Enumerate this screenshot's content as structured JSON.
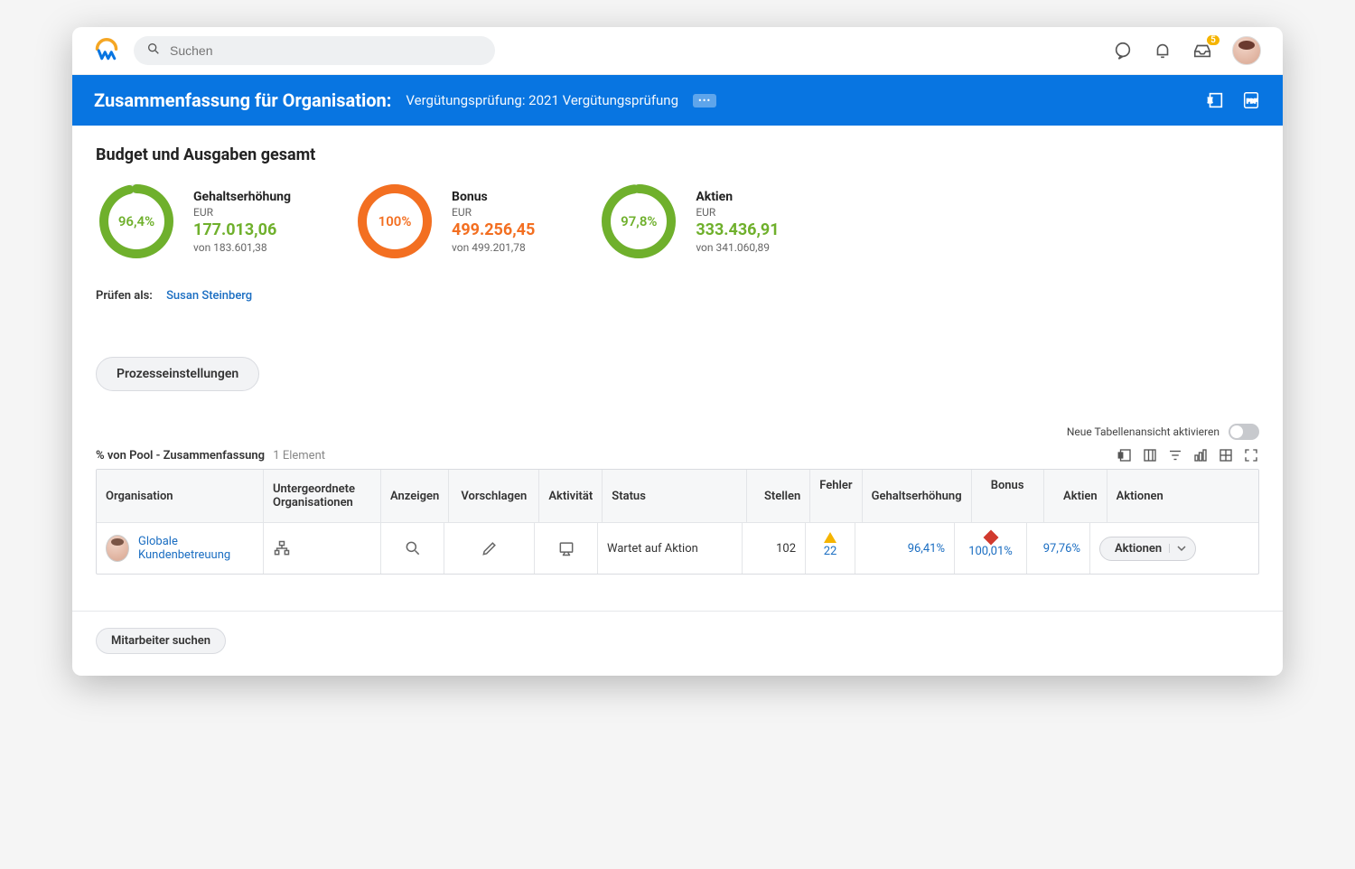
{
  "topbar": {
    "search_placeholder": "Suchen",
    "inbox_badge": "5"
  },
  "banner": {
    "title": "Zusammenfassung für Organisation:",
    "subtitle": "Vergütungsprüfung: 2021 Vergütungsprüfung"
  },
  "section": {
    "title": "Budget und Ausgaben gesamt"
  },
  "budgets": {
    "raise": {
      "percent": "96,4%",
      "percent_num": 96.4,
      "title": "Gehaltserhöhung",
      "currency": "EUR",
      "amount": "177.013,06",
      "of": "von 183.601,38",
      "color": "#6fb02c"
    },
    "bonus": {
      "percent": "100%",
      "percent_num": 100,
      "title": "Bonus",
      "currency": "EUR",
      "amount": "499.256,45",
      "of": "von 499.201,78",
      "color": "#f36f21"
    },
    "stock": {
      "percent": "97,8%",
      "percent_num": 97.8,
      "title": "Aktien",
      "currency": "EUR",
      "amount": "333.436,91",
      "of": "von 341.060,89",
      "color": "#6fb02c"
    }
  },
  "review_as": {
    "label": "Prüfen als:",
    "name": "Susan Steinberg"
  },
  "buttons": {
    "process_settings": "Prozesseinstellungen",
    "search_employees": "Mitarbeiter suchen",
    "row_actions": "Aktionen"
  },
  "toggle": {
    "label": "Neue Tabellenansicht aktivieren"
  },
  "table": {
    "caption": "% von Pool - Zusammenfassung",
    "count": "1 Element",
    "headers": {
      "org": "Organisation",
      "sub": "Untergeordnete Organisationen",
      "view": "Anzeigen",
      "suggest": "Vorschlagen",
      "activity": "Aktivität",
      "status": "Status",
      "positions": "Stellen",
      "errors": "Fehler",
      "raise": "Gehaltserhöhung",
      "bonus": "Bonus",
      "stock": "Aktien",
      "actions": "Aktionen"
    },
    "rows": [
      {
        "org": "Globale Kundenbetreuung",
        "status": "Wartet auf Aktion",
        "positions": "102",
        "errors": "22",
        "raise": "96,41%",
        "bonus": "100,01%",
        "stock": "97,76%"
      }
    ]
  }
}
